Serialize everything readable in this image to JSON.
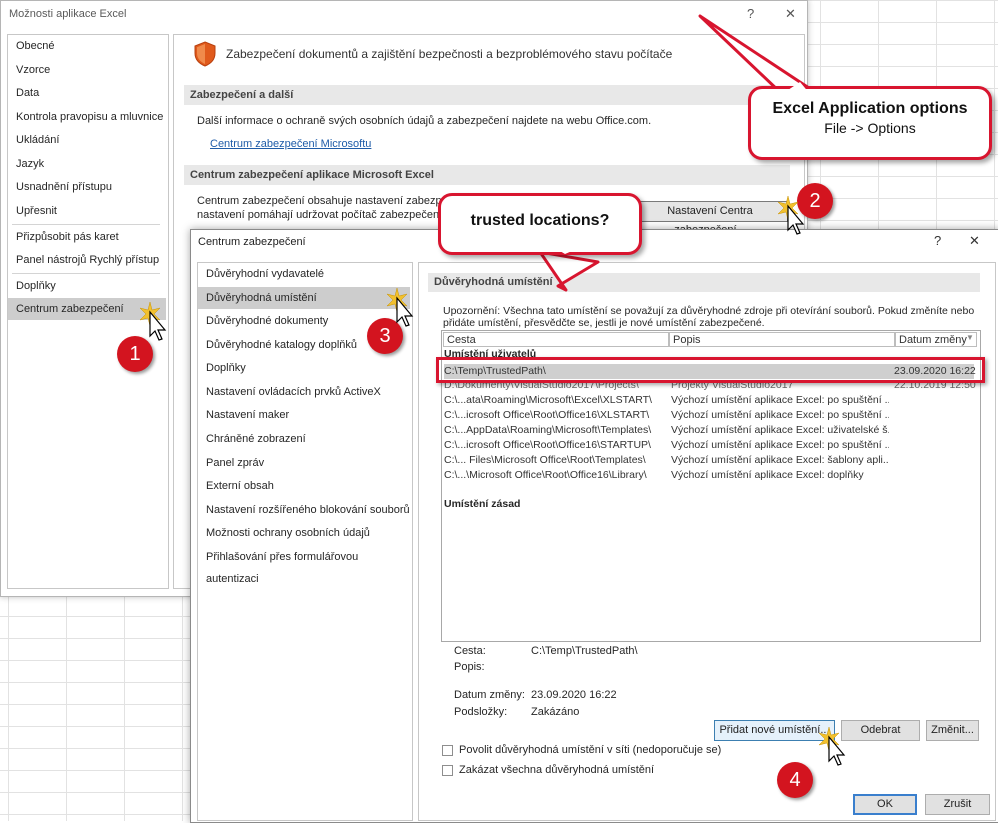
{
  "outer_dialog": {
    "title": "Možnosti aplikace Excel",
    "help": "?",
    "close": "✕",
    "nav": [
      "Obecné",
      "Vzorce",
      "Data",
      "Kontrola pravopisu a mluvnice",
      "Ukládání",
      "Jazyk",
      "Usnadnění přístupu",
      "Upřesnit",
      "Přizpůsobit pás karet",
      "Panel nástrojů Rychlý přístup",
      "Doplňky",
      "Centrum zabezpečení"
    ],
    "heading": "Zabezpečení dokumentů a zajištění bezpečnosti a bezproblémového stavu počítače",
    "section1_title": "Zabezpečení a další",
    "section1_text": "Další informace o ochraně svých osobních údajů a zabezpečení najdete na webu Office.com.",
    "section1_link": "Centrum zabezpečení Microsoftu",
    "section2_title": "Centrum zabezpečení aplikace Microsoft Excel",
    "section2_line1": "Centrum zabezpečení obsahuje nastavení zabezpeč",
    "section2_line2": "nastavení pomáhají udržovat počítač zabezpečený. D",
    "trust_center_button": "Nastavení Centra zabezpečení..."
  },
  "trust_dialog": {
    "title": "Centrum zabezpečení",
    "help": "?",
    "close": "✕",
    "nav": [
      "Důvěryhodní vydavatelé",
      "Důvěryhodná umístění",
      "Důvěryhodné dokumenty",
      "Důvěryhodné katalogy doplňků",
      "Doplňky",
      "Nastavení ovládacích prvků ActiveX",
      "Nastavení maker",
      "Chráněné zobrazení",
      "Panel zpráv",
      "Externí obsah",
      "Nastavení rozšířeného blokování souborů",
      "Možnosti ochrany osobních údajů",
      "Přihlašování přes formulářovou autentizaci"
    ],
    "selected_index": 1,
    "section_title": "Důvěryhodná umístění",
    "warning_line1": "Upozornění: Všechna tato umístění se považují za důvěryhodné zdroje při otevírání souborů. Pokud změníte nebo",
    "warning_line2": "přidáte umístění, přesvědčte se, jestli je nové umístění zabezpečené.",
    "columns": [
      "Cesta",
      "Popis",
      "Datum změny"
    ],
    "group_user": "Umístění uživatelů",
    "group_policy": "Umístění zásad",
    "rows": [
      {
        "path": "C:\\Temp\\TrustedPath\\",
        "desc": "",
        "date": "23.09.2020 16:22"
      },
      {
        "path": "D:\\Dokumenty\\VisualStudio2017\\Projects\\",
        "desc": "Projekty VisualStudio2017",
        "date": "22.10.2019 12:50"
      },
      {
        "path": "C:\\...ata\\Roaming\\Microsoft\\Excel\\XLSTART\\",
        "desc": "Výchozí umístění aplikace Excel: po spuštění ...",
        "date": ""
      },
      {
        "path": "C:\\...icrosoft Office\\Root\\Office16\\XLSTART\\",
        "desc": "Výchozí umístění aplikace Excel: po spuštění ...",
        "date": ""
      },
      {
        "path": "C:\\...AppData\\Roaming\\Microsoft\\Templates\\",
        "desc": "Výchozí umístění aplikace Excel: uživatelské š...",
        "date": ""
      },
      {
        "path": "C:\\...icrosoft Office\\Root\\Office16\\STARTUP\\",
        "desc": "Výchozí umístění aplikace Excel: po spuštění ...",
        "date": ""
      },
      {
        "path": "C:\\... Files\\Microsoft Office\\Root\\Templates\\",
        "desc": "Výchozí umístění aplikace Excel: šablony apli...",
        "date": ""
      },
      {
        "path": "C:\\...\\Microsoft Office\\Root\\Office16\\Library\\",
        "desc": "Výchozí umístění aplikace Excel: doplňky",
        "date": ""
      }
    ],
    "detail_path_label": "Cesta:",
    "detail_path_value": "C:\\Temp\\TrustedPath\\",
    "detail_desc_label": "Popis:",
    "detail_date_label": "Datum změny:",
    "detail_date_value": "23.09.2020 16:22",
    "detail_sub_label": "Podsložky:",
    "detail_sub_value": "Zakázáno",
    "btn_add": "Přidat nové umístění...",
    "btn_remove": "Odebrat",
    "btn_modify": "Změnit...",
    "chk_network": "Povolit důvěryhodná umístění v síti (nedoporučuje se)",
    "chk_disable": "Zakázat všechna důvěryhodná umístění",
    "btn_ok": "OK",
    "btn_cancel": "Zrušit"
  },
  "annotations": {
    "callout_main_title": "Excel Application options",
    "callout_main_sub": "File -> Options",
    "callout_trusted": "trusted locations?",
    "badges": [
      "1",
      "2",
      "3",
      "4"
    ]
  },
  "colors": {
    "accent_red": "#d8152f",
    "selection_gray": "#cdcdcd",
    "shield_orange": "#e05a1c"
  }
}
